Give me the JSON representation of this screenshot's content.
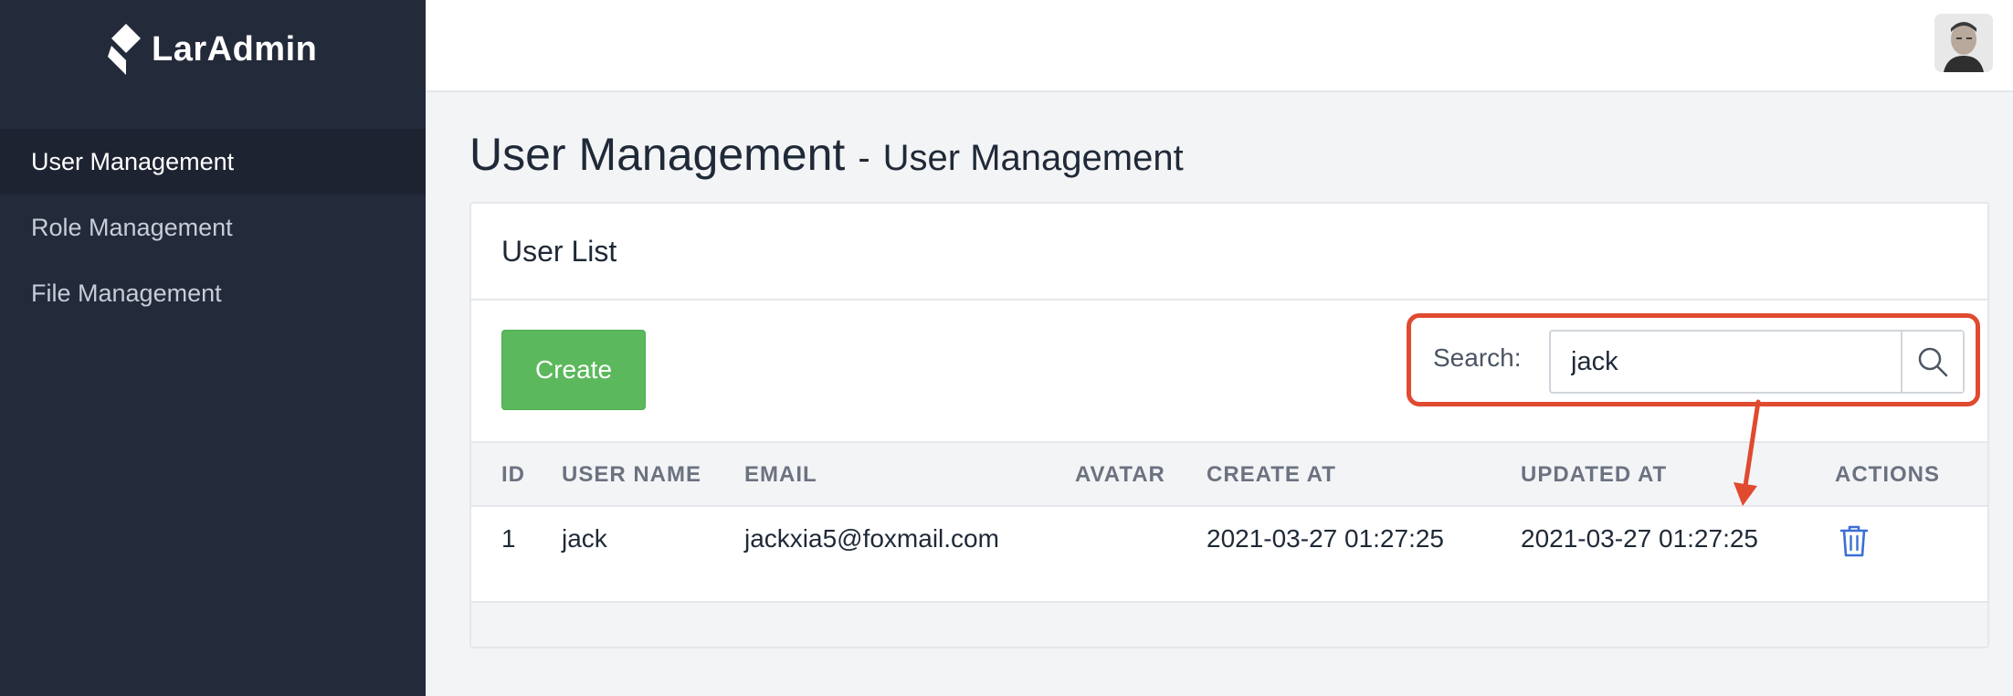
{
  "app": {
    "logo_text": "LarAdmin"
  },
  "sidebar": {
    "items": [
      {
        "label": "User Management",
        "active": true
      },
      {
        "label": "Role Management",
        "active": false
      },
      {
        "label": "File Management",
        "active": false
      }
    ]
  },
  "page": {
    "title": "User Management",
    "separator": "-",
    "subtitle": "User Management"
  },
  "card": {
    "title": "User List",
    "create_label": "Create",
    "search": {
      "label": "Search:",
      "value": "jack"
    }
  },
  "table": {
    "columns": [
      "ID",
      "USER NAME",
      "EMAIL",
      "AVATAR",
      "CREATE AT",
      "UPDATED AT",
      "ACTIONS"
    ],
    "rows": [
      {
        "id": "1",
        "username": "jack",
        "email": "jackxia5@foxmail.com",
        "avatar": "",
        "created_at": "2021-03-27 01:27:25",
        "updated_at": "2021-03-27 01:27:25"
      }
    ]
  },
  "icons": {
    "search": "search-icon",
    "delete": "trash-icon",
    "logo": "laradmin-logo-icon",
    "avatar": "user-avatar"
  },
  "colors": {
    "sidebar": "#232a3a",
    "create_button": "#5cb85c",
    "highlight": "#e04a2f",
    "link": "#3b6fd6"
  }
}
